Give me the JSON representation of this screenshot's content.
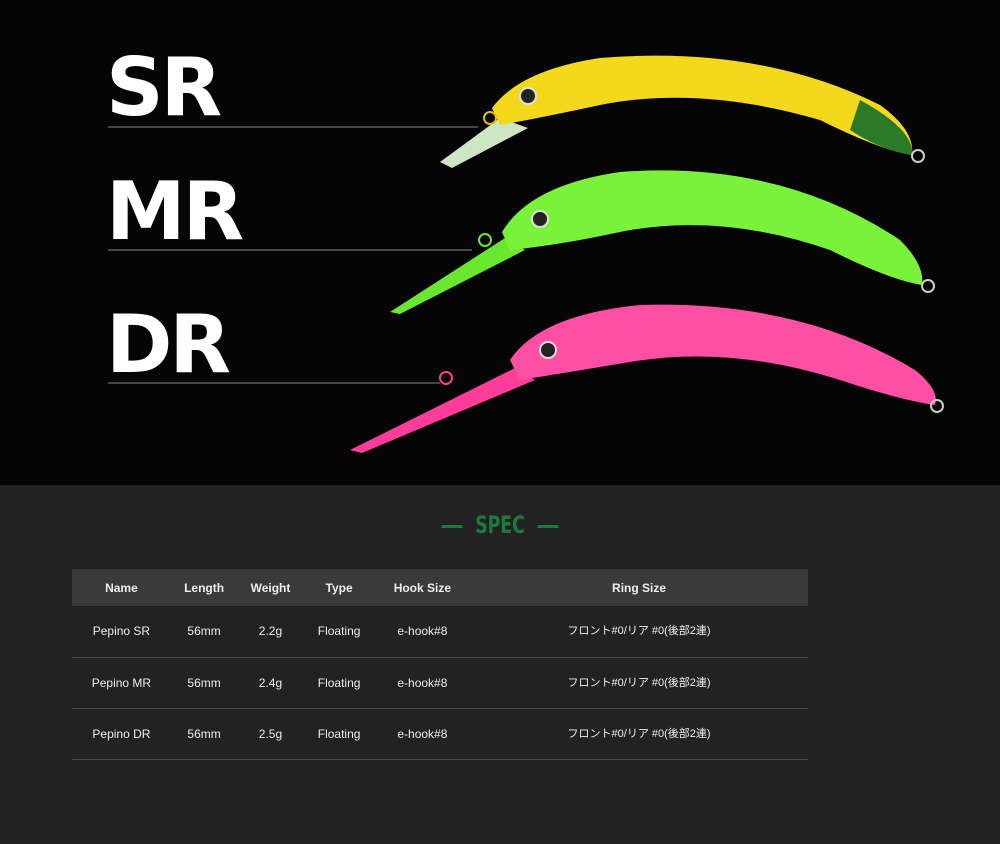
{
  "hero": {
    "labels": [
      "SR",
      "MR",
      "DR"
    ],
    "colors": {
      "sr": "#f3d81c",
      "mr": "#7af23a",
      "dr": "#ff4fa4"
    }
  },
  "spec": {
    "title": "SPEC",
    "accent": "#1e7a3c"
  },
  "table": {
    "headers": [
      "Name",
      "Length",
      "Weight",
      "Type",
      "Hook Size",
      "Ring Size"
    ],
    "rows": [
      [
        "Pepino SR",
        "56mm",
        "2.2g",
        "Floating",
        "e-hook#8",
        "フロント#0/リア #0(後部2連)"
      ],
      [
        "Pepino MR",
        "56mm",
        "2.4g",
        "Floating",
        "e-hook#8",
        "フロント#0/リア #0(後部2連)"
      ],
      [
        "Pepino DR",
        "56mm",
        "2.5g",
        "Floating",
        "e-hook#8",
        "フロント#0/リア #0(後部2連)"
      ]
    ]
  }
}
